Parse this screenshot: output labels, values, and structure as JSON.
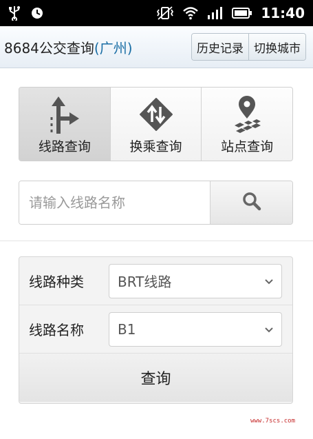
{
  "status_bar": {
    "time": "11:40",
    "icons": [
      "usb-icon",
      "alarm-clock-icon",
      "vibrate-icon",
      "wifi-icon",
      "signal-icon",
      "battery-icon"
    ]
  },
  "header": {
    "title": "8684公交查询",
    "city": "(广州)",
    "buttons": {
      "history": "历史记录",
      "switch_city": "切换城市"
    }
  },
  "modes": [
    {
      "label": "线路查询",
      "icon": "route-arrow-icon",
      "active": true
    },
    {
      "label": "换乘查询",
      "icon": "transfer-diamond-icon",
      "active": false
    },
    {
      "label": "站点查询",
      "icon": "map-pin-icon",
      "active": false
    }
  ],
  "search": {
    "placeholder": "请输入线路名称",
    "button_icon": "search-icon"
  },
  "form": {
    "type_label": "线路种类",
    "type_value": "BRT线路",
    "name_label": "线路名称",
    "name_value": "B1",
    "submit": "查询"
  },
  "watermark": "www.7scs.com",
  "colors": {
    "city": "#1a6ea5",
    "watermark": "#c62828"
  }
}
